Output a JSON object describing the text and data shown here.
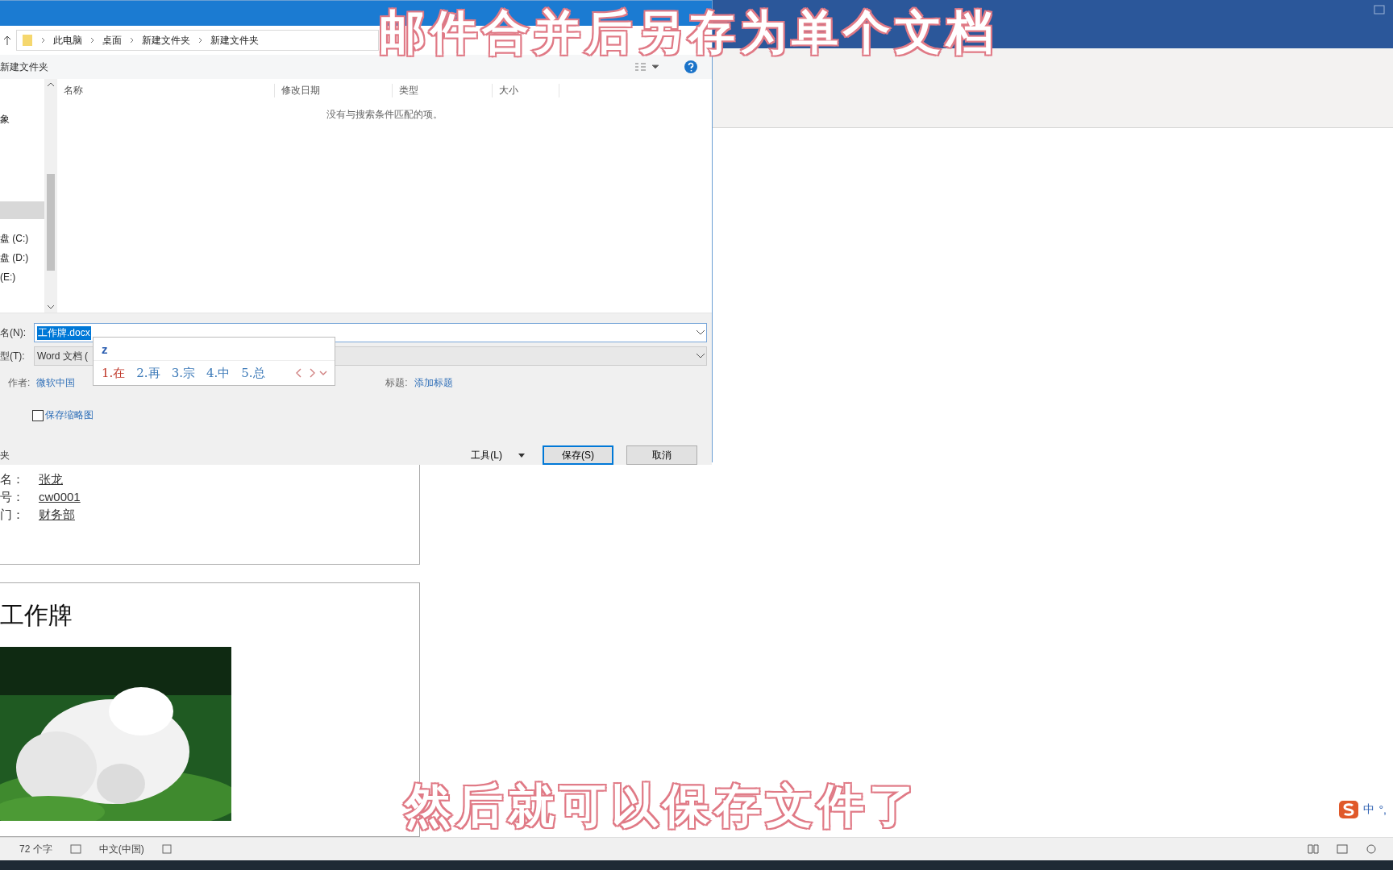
{
  "captions": {
    "top": "邮件合并后另存为单个文档",
    "bottom": "然后就可以保存文件了"
  },
  "save_dialog": {
    "breadcrumb": [
      "此电脑",
      "桌面",
      "新建文件夹",
      "新建文件夹"
    ],
    "new_folder": "新建文件夹",
    "nav_items": [
      {
        "label": "象"
      },
      {
        "label": "盘 (C:)"
      },
      {
        "label": "盘 (D:)"
      },
      {
        "label": "(E:)"
      }
    ],
    "columns": [
      "名称",
      "修改日期",
      "类型",
      "大小"
    ],
    "empty_message": "没有与搜索条件匹配的项。",
    "file_name": {
      "label": "名(N):",
      "value": "工作牌.docx"
    },
    "file_type": {
      "label": "型(T):",
      "value": "Word 文档 ("
    },
    "author": {
      "label": "作者:",
      "value": "微软中国"
    },
    "title_field": {
      "label": "标题:",
      "value": "添加标题"
    },
    "thumbnail": {
      "label": "保存缩略图",
      "checked": false
    },
    "footer_left": "夹",
    "tools": "工具(L)",
    "buttons": [
      {
        "label": "保存(S)",
        "kind": "primary"
      },
      {
        "label": "取消",
        "kind": "normal"
      }
    ]
  },
  "ime": {
    "input": "z",
    "candidates": [
      {
        "label": "1.在",
        "selected": true
      },
      {
        "label": "2.再",
        "selected": false
      },
      {
        "label": "3.宗",
        "selected": false
      },
      {
        "label": "4.中",
        "selected": false
      },
      {
        "label": "5.总",
        "selected": false
      }
    ]
  },
  "document": {
    "fields": [
      {
        "label": "名：",
        "value": "张龙"
      },
      {
        "label": "号：",
        "value": "cw0001"
      },
      {
        "label": "门：",
        "value": "财务部"
      }
    ],
    "heading": "工作牌"
  },
  "status_bar": {
    "word_count": "72 个字",
    "language": "中文(中国)"
  },
  "ime_status": {
    "mode": "中",
    "punct": "°,"
  }
}
